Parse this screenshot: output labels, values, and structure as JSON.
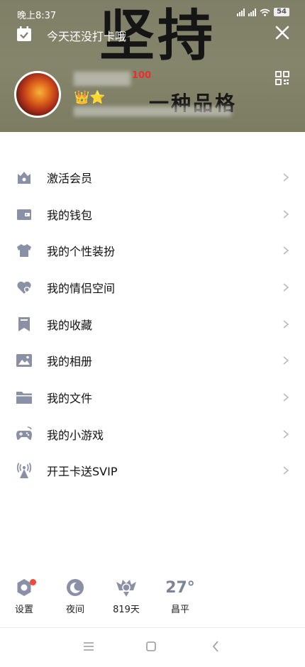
{
  "status_bar": {
    "time": "晚上8:37",
    "battery": "54"
  },
  "header": {
    "checkin_text": "今天还没打卡哦",
    "banner_big": "坚持",
    "banner_sub": "一种品格",
    "badge_score": "100",
    "badges": "👑⭐"
  },
  "menu": {
    "items": [
      {
        "label": "激活会员",
        "icon": "crown-box-icon"
      },
      {
        "label": "我的钱包",
        "icon": "wallet-icon"
      },
      {
        "label": "我的个性装扮",
        "icon": "tshirt-icon"
      },
      {
        "label": "我的情侣空间",
        "icon": "heart-icon"
      },
      {
        "label": "我的收藏",
        "icon": "bookmark-icon"
      },
      {
        "label": "我的相册",
        "icon": "photo-icon"
      },
      {
        "label": "我的文件",
        "icon": "folder-icon"
      },
      {
        "label": "我的小游戏",
        "icon": "gamepad-icon"
      },
      {
        "label": "开王卡送SVIP",
        "icon": "signal-tower-icon"
      }
    ]
  },
  "bottom": {
    "settings_label": "设置",
    "night_label": "夜间",
    "days_label": "819天",
    "temperature": "27°",
    "city_label": "昌平"
  },
  "colors": {
    "icon_gray": "#8a91a6",
    "banner_bg": "#808068",
    "red_dot": "#f04a3c"
  }
}
